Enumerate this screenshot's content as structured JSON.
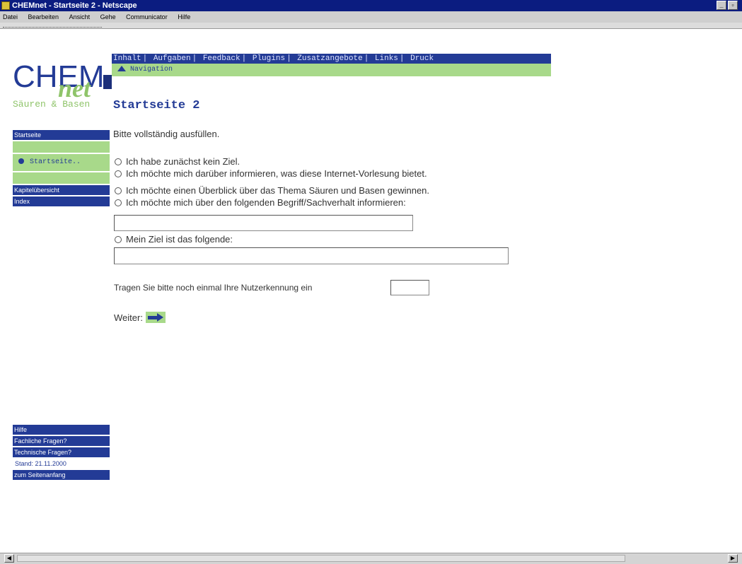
{
  "window": {
    "title": "CHEMnet - Startseite 2 - Netscape",
    "buttons": [
      "_",
      "▫",
      "×"
    ]
  },
  "menubar": [
    "Datei",
    "Bearbeiten",
    "Ansicht",
    "Gehe",
    "Communicator",
    "Hilfe"
  ],
  "logo": {
    "chem": "CHEM",
    "net": "net"
  },
  "subtitle": "Säuren & Basen",
  "topnav": [
    "Inhalt",
    "Aufgaben",
    "Feedback",
    "Plugins",
    "Zusatzangebote",
    "Links",
    "Druck"
  ],
  "subnav": {
    "label": "Navigation"
  },
  "page_title": "Startseite 2",
  "sidebar": {
    "startseite": "Startseite",
    "active_item": "Startseite..",
    "kapitel": "Kapitelübersicht",
    "index": "Index",
    "hilfe": "Hilfe",
    "fachliche": "Fachliche Fragen?",
    "technische": "Technische Fragen?",
    "stand": "Stand: 21.11.2000",
    "seitenanfang": "zum Seitenanfang"
  },
  "form": {
    "instruction": "Bitte vollständig ausfüllen.",
    "options": [
      "Ich habe zunächst kein Ziel.",
      "Ich möchte mich darüber informieren, was diese Internet-Vorlesung bietet.",
      "Ich möchte einen Überblick über das Thema Säuren und Basen gewinnen.",
      "Ich möchte mich über den folgenden Begriff/Sachverhalt informieren:",
      "Mein Ziel ist das folgende:"
    ],
    "begriff_value": "",
    "ziel_value": "",
    "nutzerkennung_label": "Tragen Sie bitte noch einmal Ihre Nutzerkennung ein",
    "nutzerkennung_value": "",
    "weiter_label": "Weiter:"
  },
  "colors": {
    "brand_blue": "#233b96",
    "brand_green": "#a8d98a",
    "titlebar": "#0b1c80"
  }
}
